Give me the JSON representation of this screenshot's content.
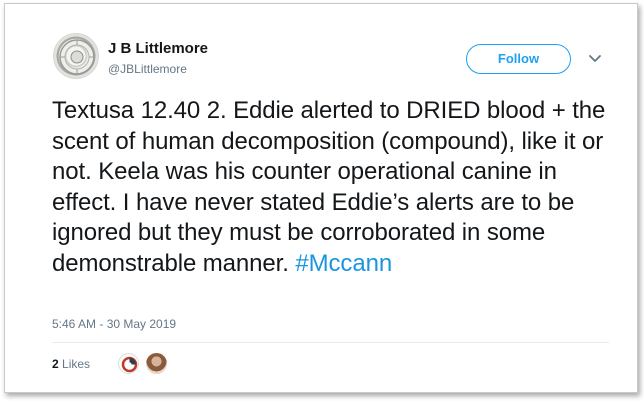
{
  "tweet": {
    "display_name": "J B Littlemore",
    "handle": "@JBLittlemore",
    "follow_label": "Follow",
    "text": "Textusa 12.40 2. Eddie alerted to DRIED blood + the scent of human decomposition (compound), like it or not. Keela was his counter operational canine in effect. I have never stated Eddie’s alerts are to be ignored but they must be corroborated in some demonstrable manner.",
    "hashtag": "#Mccann",
    "timestamp": "5:46 AM - 30 May 2019",
    "likes_count": "2",
    "likes_label": "Likes"
  },
  "icons": {
    "more_menu": "chevron-down-icon"
  },
  "colors": {
    "accent": "#1da1f2",
    "hashtag": "#1b95e0",
    "secondary_text": "#657786",
    "primary_text": "#14171a",
    "divider": "#e6ecf0"
  }
}
